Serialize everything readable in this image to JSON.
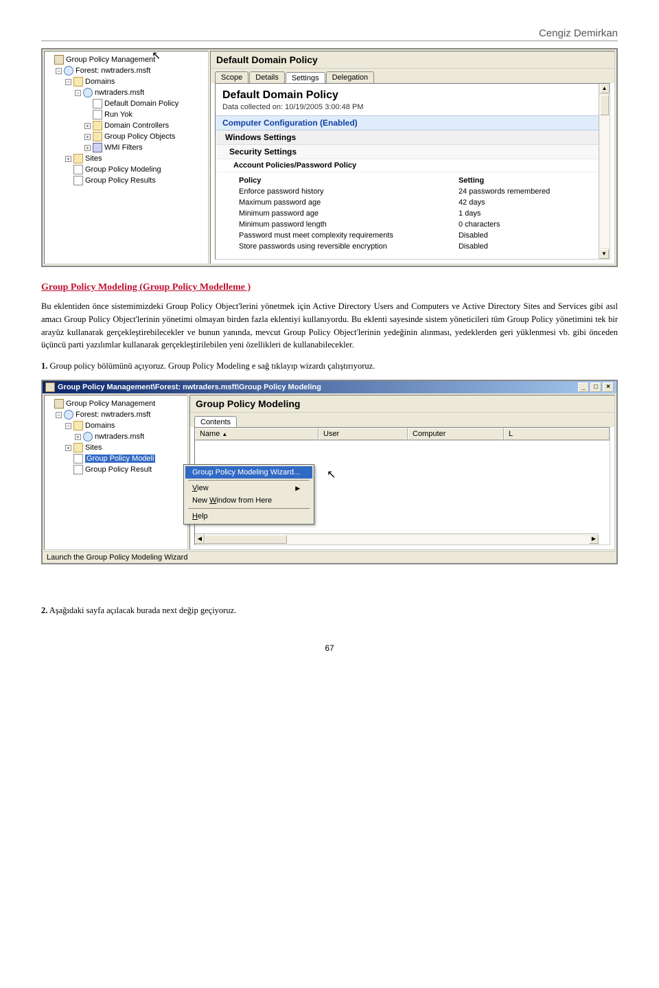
{
  "header": {
    "author": "Cengiz Demirkan"
  },
  "screenshot1": {
    "tree": {
      "root": "Group Policy Management",
      "forest": "Forest: nwtraders.msft",
      "domains": "Domains",
      "domain": "nwtraders.msft",
      "items": [
        "Default Domain Policy",
        "Run Yok",
        "Domain Controllers",
        "Group Policy Objects",
        "WMI Filters"
      ],
      "sites": "Sites",
      "modeling": "Group Policy Modeling",
      "results": "Group Policy Results"
    },
    "right": {
      "title": "Default Domain Policy",
      "tabs": [
        "Scope",
        "Details",
        "Settings",
        "Delegation"
      ],
      "rpt_title": "Default Domain Policy",
      "rpt_date": "Data collected on: 10/19/2005 3:00:48 PM",
      "h1": "Computer Configuration (Enabled)",
      "h2": "Windows Settings",
      "h3": "Security Settings",
      "h4": "Account Policies/Password Policy",
      "th_policy": "Policy",
      "th_setting": "Setting",
      "rows": [
        {
          "p": "Enforce password history",
          "s": "24 passwords remembered"
        },
        {
          "p": "Maximum password age",
          "s": "42 days"
        },
        {
          "p": "Minimum password age",
          "s": "1 days"
        },
        {
          "p": "Minimum password length",
          "s": "0 characters"
        },
        {
          "p": "Password must meet complexity requirements",
          "s": "Disabled"
        },
        {
          "p": "Store passwords using reversible encryption",
          "s": "Disabled"
        }
      ]
    }
  },
  "doc": {
    "heading": "Group Policy Modeling (Group Policy Modelleme )",
    "para": "Bu eklentiden önce sistemimizdeki Group Policy Object'lerini yönetmek için Active Directory Users and Computers ve Active Directory Sites and Services gibi asıl amacı Group Policy Object'lerinin yönetimi olmayan birden fazla eklentiyi kullanıyordu. Bu eklenti sayesinde  sistem yöneticileri tüm Group Policy yönetimini tek bir arayüz kullanarak gerçekleştirebilecekler ve bunun yanında, mevcut Group Policy Object'lerinin yedeğinin alınması, yedeklerden geri yüklenmesi vb. gibi önceden üçüncü parti yazılımlar kullanarak gerçekleştirilebilen yeni  özellikleri de kullanabilecekler.",
    "step1_b": "1.",
    "step1": " Group policy bölümünü açıyoruz. Group Policy Modeling e sağ tıklayıp wizardı çalıştırıyoruz.",
    "step2_b": "2.",
    "step2": "  Aşağıdaki sayfa açılacak burada next değip geçiyoruz."
  },
  "screenshot2": {
    "title": "Group Policy Management\\Forest: nwtraders.msft\\Group Policy Modeling",
    "tree": {
      "root": "Group Policy Management",
      "forest": "Forest: nwtraders.msft",
      "domains": "Domains",
      "domain": "nwtraders.msft",
      "sites": "Sites",
      "modeling": "Group Policy Modeli",
      "results": "Group Policy Result"
    },
    "right": {
      "title": "Group Policy Modeling",
      "tab": "Contents",
      "cols": {
        "name": "Name",
        "user": "User",
        "computer": "Computer",
        "last": "L"
      }
    },
    "menu": {
      "wizard": "Group Policy Modeling Wizard...",
      "view": "View",
      "newwin": "New Window from Here",
      "help": "Help"
    },
    "status": "Launch the Group Policy Modeling Wizard"
  },
  "pagenum": "67"
}
